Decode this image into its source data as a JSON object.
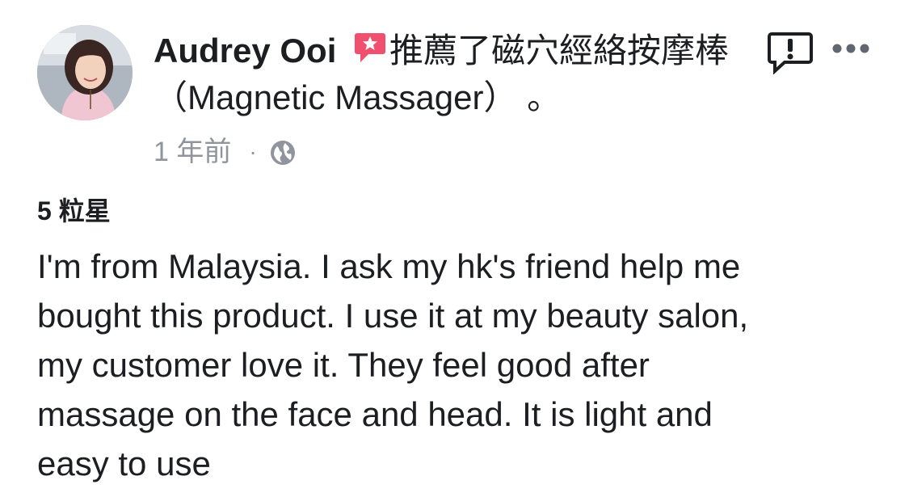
{
  "post": {
    "author_name": "Audrey Ooi",
    "action_text": "推薦了磁穴經絡按摩棒 （Magnetic Massager） 。",
    "timestamp": "1 年前",
    "separator": "·",
    "privacy_icon": "globe-icon",
    "recommend_icon": "recommend-icon",
    "rating_text": "5 粒星",
    "review_text": "I'm from Malaysia. I ask my hk's friend help me\nbought this product. I use it at my beauty salon,\nmy customer love it. They feel good after\nmassage on the face and head. It is light and\neasy to use"
  },
  "actions": {
    "report_icon": "report-icon",
    "more_icon": "more-icon"
  },
  "colors": {
    "text_primary": "#1c1e21",
    "text_secondary": "#90949c",
    "recommend_red": "#f0506e"
  }
}
